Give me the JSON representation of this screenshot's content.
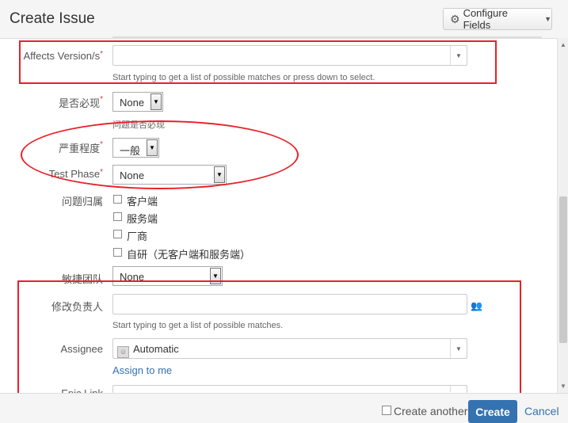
{
  "header": {
    "title": "Create Issue",
    "configure_fields_label": "Configure Fields"
  },
  "fields": {
    "affects_version": {
      "label": "Affects Version/s",
      "required_mark": "*",
      "value": "",
      "hint": "Start typing to get a list of possible matches or press down to select."
    },
    "reproducible": {
      "label": "是否必现",
      "required_mark": "*",
      "value": "None",
      "hint": "问题是否必现"
    },
    "severity": {
      "label": "严重程度",
      "required_mark": "*",
      "value": "一般"
    },
    "test_phase": {
      "label": "Test Phase",
      "required_mark": "*",
      "value": "None"
    },
    "issue_owner": {
      "label": "问题归属",
      "options": [
        "客户端",
        "服务端",
        "厂商",
        "自研（无客户端和服务端）"
      ]
    },
    "agile_team": {
      "label": "敏捷团队",
      "value": "None"
    },
    "fix_owner": {
      "label": "修改负责人",
      "value": "",
      "hint": "Start typing to get a list of possible matches."
    },
    "assignee": {
      "label": "Assignee",
      "value": "Automatic",
      "assign_to_me": "Assign to me"
    },
    "epic_link": {
      "label": "Epic Link"
    }
  },
  "footer": {
    "create_another_label": "Create another",
    "create_label": "Create",
    "cancel_label": "Cancel"
  },
  "icons": {
    "configure": "gear-icon",
    "user_picker": "people-icon",
    "dropdown": "chevron-down-icon"
  },
  "colors": {
    "accent": "#3572b0",
    "required": "#d04437",
    "annotation": "#e8202a"
  }
}
